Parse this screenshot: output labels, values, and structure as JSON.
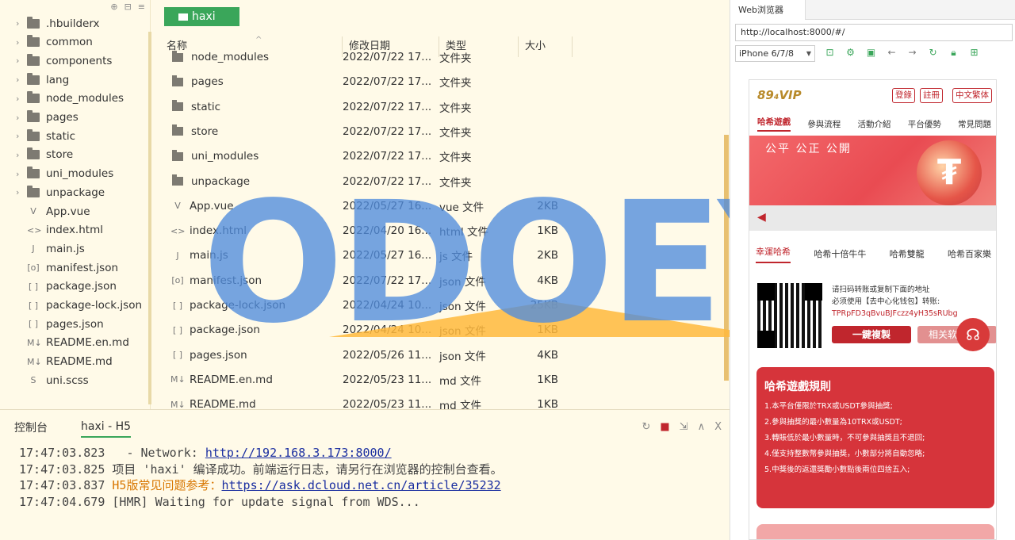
{
  "tree": {
    "items": [
      {
        "label": ".hbuilderx",
        "kind": "folder"
      },
      {
        "label": "common",
        "kind": "folder"
      },
      {
        "label": "components",
        "kind": "folder"
      },
      {
        "label": "lang",
        "kind": "folder"
      },
      {
        "label": "node_modules",
        "kind": "folder"
      },
      {
        "label": "pages",
        "kind": "folder"
      },
      {
        "label": "static",
        "kind": "folder"
      },
      {
        "label": "store",
        "kind": "folder"
      },
      {
        "label": "uni_modules",
        "kind": "folder"
      },
      {
        "label": "unpackage",
        "kind": "folder"
      },
      {
        "label": "App.vue",
        "kind": "file",
        "icon": "V"
      },
      {
        "label": "index.html",
        "kind": "file",
        "icon": "<>"
      },
      {
        "label": "main.js",
        "kind": "file",
        "icon": "J"
      },
      {
        "label": "manifest.json",
        "kind": "file",
        "icon": "[o]"
      },
      {
        "label": "package.json",
        "kind": "file",
        "icon": "[ ]"
      },
      {
        "label": "package-lock.json",
        "kind": "file",
        "icon": "[ ]"
      },
      {
        "label": "pages.json",
        "kind": "file",
        "icon": "[ ]"
      },
      {
        "label": "README.en.md",
        "kind": "file",
        "icon": "M↓"
      },
      {
        "label": "README.md",
        "kind": "file",
        "icon": "M↓"
      },
      {
        "label": "uni.scss",
        "kind": "file",
        "icon": "S"
      }
    ]
  },
  "explorer": {
    "folder_tab": "haxi",
    "headers": {
      "name": "名称",
      "date": "修改日期",
      "type": "类型",
      "size": "大小"
    },
    "rows": [
      {
        "name": "node_modules",
        "date": "2022/07/22 17...",
        "type": "文件夹",
        "size": "",
        "kind": "folder"
      },
      {
        "name": "pages",
        "date": "2022/07/22 17...",
        "type": "文件夹",
        "size": "",
        "kind": "folder"
      },
      {
        "name": "static",
        "date": "2022/07/22 17...",
        "type": "文件夹",
        "size": "",
        "kind": "folder"
      },
      {
        "name": "store",
        "date": "2022/07/22 17...",
        "type": "文件夹",
        "size": "",
        "kind": "folder"
      },
      {
        "name": "uni_modules",
        "date": "2022/07/22 17...",
        "type": "文件夹",
        "size": "",
        "kind": "folder"
      },
      {
        "name": "unpackage",
        "date": "2022/07/22 17...",
        "type": "文件夹",
        "size": "",
        "kind": "folder"
      },
      {
        "name": "App.vue",
        "date": "2022/05/27 16...",
        "type": "vue 文件",
        "size": "2KB",
        "kind": "file",
        "icon": "V"
      },
      {
        "name": "index.html",
        "date": "2022/04/20 16...",
        "type": "html 文件",
        "size": "1KB",
        "kind": "file",
        "icon": "<>"
      },
      {
        "name": "main.js",
        "date": "2022/05/27 16...",
        "type": "js 文件",
        "size": "2KB",
        "kind": "file",
        "icon": "J"
      },
      {
        "name": "manifest.json",
        "date": "2022/07/22 17...",
        "type": "json 文件",
        "size": "4KB",
        "kind": "file",
        "icon": "[o]"
      },
      {
        "name": "package-lock.json",
        "date": "2022/04/24 10...",
        "type": "json 文件",
        "size": "25KB",
        "kind": "file",
        "icon": "[ ]"
      },
      {
        "name": "package.json",
        "date": "2022/04/24 10...",
        "type": "json 文件",
        "size": "1KB",
        "kind": "file",
        "icon": "[ ]"
      },
      {
        "name": "pages.json",
        "date": "2022/05/26 11...",
        "type": "json 文件",
        "size": "4KB",
        "kind": "file",
        "icon": "[ ]"
      },
      {
        "name": "README.en.md",
        "date": "2022/05/23 11...",
        "type": "md 文件",
        "size": "1KB",
        "kind": "file",
        "icon": "M↓"
      },
      {
        "name": "README.md",
        "date": "2022/05/23 11...",
        "type": "md 文件",
        "size": "1KB",
        "kind": "file",
        "icon": "M↓"
      }
    ]
  },
  "watermark": {
    "text": "ODOEYC"
  },
  "console": {
    "tabs": [
      "控制台",
      "haxi - H5"
    ],
    "lines": [
      {
        "time": "17:47:03.823",
        "pre": "  - Network: ",
        "link": "http://192.168.3.173:8000/",
        "post": ""
      },
      {
        "time": "17:47:03.825",
        "pre": "项目 'haxi' 编译成功。前端运行日志，请另行在浏览器的控制台查看。",
        "link": "",
        "post": ""
      },
      {
        "time": "17:47:03.837",
        "orange": "H5版常见问题参考：",
        "link": "https://ask.dcloud.net.cn/article/35232",
        "post": ""
      },
      {
        "time": "17:47:04.679",
        "pre": "[HMR] Waiting for update signal from WDS...",
        "link": "",
        "post": ""
      }
    ]
  },
  "browser": {
    "tab": "Web浏览器",
    "url": "http://localhost:8000/#/",
    "device": "iPhone 6/7/8"
  },
  "phone": {
    "logo": "89₄VIP",
    "buttons": [
      "登錄",
      "註冊",
      "中文繁体"
    ],
    "nav": [
      "哈希遊戲",
      "參與流程",
      "活動介紹",
      "平台優勢",
      "常見問題"
    ],
    "banner_text": "公平  公正  公開",
    "games": [
      "幸運哈希",
      "哈希十倍牛牛",
      "哈希雙龍",
      "哈希百家樂"
    ],
    "pay_line1": "请扫码转账或复制下面的地址",
    "pay_line2": "必须使用【去中心化钱包】转账:",
    "pay_addr": "TPRpFD3qBvuBJFczz4yH35sRUbg",
    "copy_btn": "一鍵複製",
    "soft_btn": "相关软件下载",
    "rules_title": "哈希遊戲規則",
    "rules": [
      "1.本平台僅限於TRX或USDT參與抽獎;",
      "2.參與抽獎的最小數量為10TRX或USDT;",
      "3.轉賬低於最小數量時，不可參與抽獎且不退回;",
      "4.僅支持整數幣參與抽獎，小數部分將自動忽略;",
      "5.中獎後的返還獎勵小數點後兩位四捨五入;"
    ]
  }
}
